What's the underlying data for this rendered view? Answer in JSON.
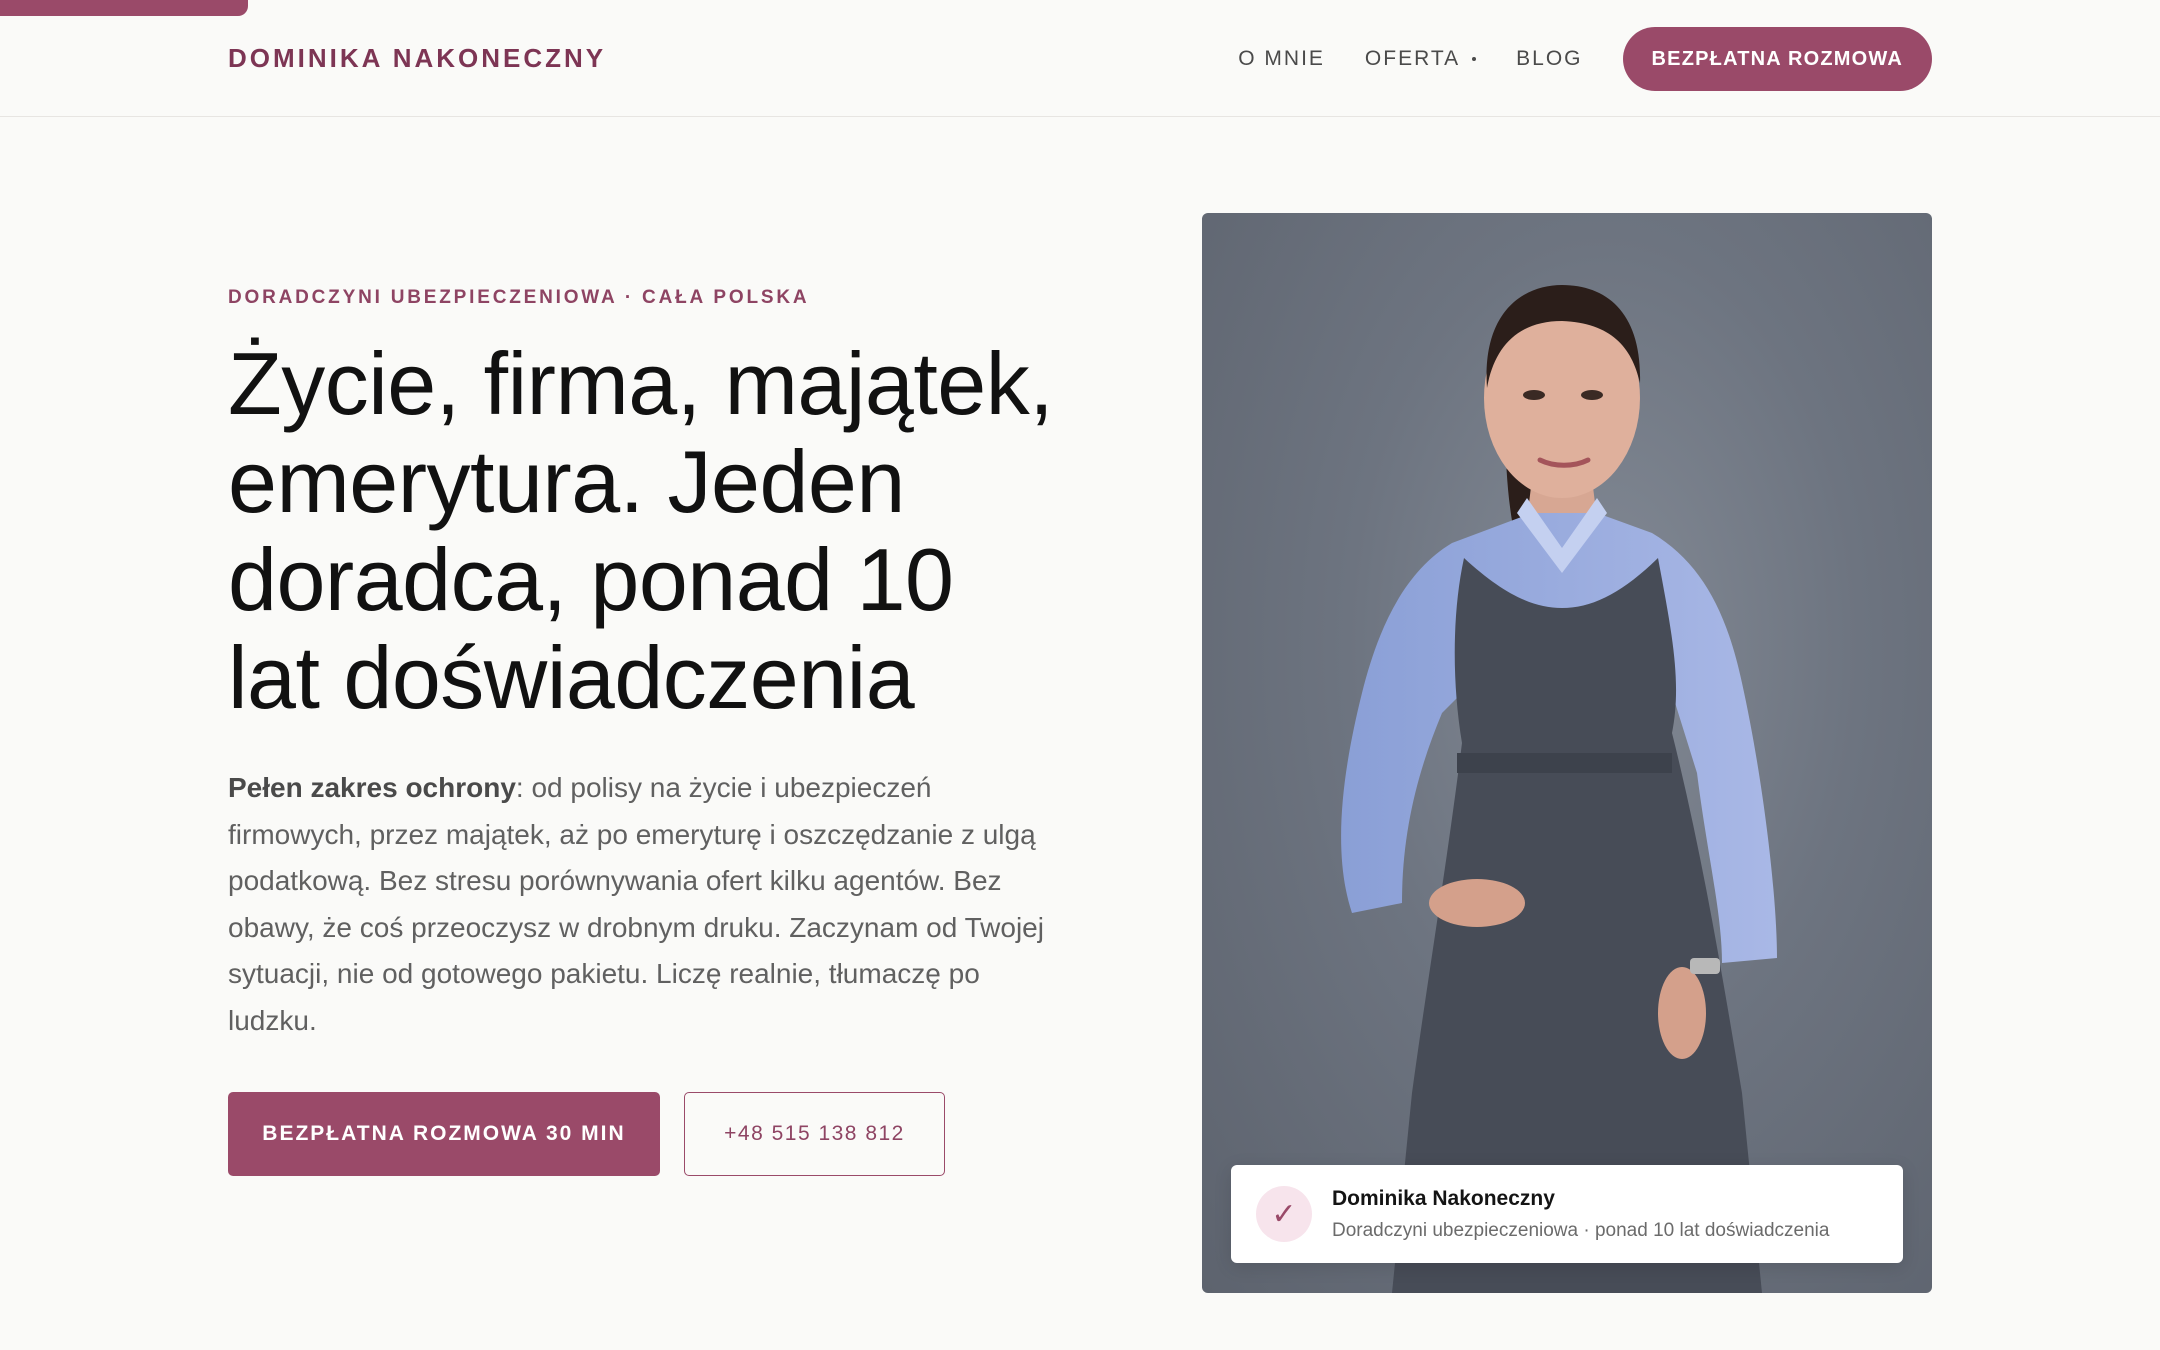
{
  "header": {
    "brand": "DOMINIKA NAKONECZNY",
    "nav": [
      {
        "label": "O MNIE"
      },
      {
        "label": "OFERTA"
      },
      {
        "label": "BLOG"
      }
    ],
    "cta_label": "BEZPŁATNA ROZMOWA"
  },
  "hero": {
    "eyebrow": "DORADCZYNI UBEZPIECZENIOWA · CAŁA POLSKA",
    "title_lines": [
      "Życie, firma, majątek,",
      "emerytura. Jeden",
      "doradca, ponad 10",
      "lat doświadczenia"
    ],
    "description_bold": "Pełen zakres ochrony",
    "description_rest": ": od polisy na życie i ubezpieczeń firmowych, przez majątek, aż po emeryturę i oszczędzanie z ulgą podatkową. Bez stresu porównywania ofert kilku agentów. Bez obawy, że coś przeoczysz w drobnym druku. Zaczynam od Twojej sytuacji, nie od gotowego pakietu. Liczę realnie, tłumaczę po ludzku.",
    "primary_button": "BEZPŁATNA ROZMOWA 30 MIN",
    "phone_button": "+48 515 138 812"
  },
  "portrait_card": {
    "check_icon": "✓",
    "name": "Dominika Nakoneczny",
    "subtitle": "Doradczyni ubezpieczeniowa · ponad 10 lat doświadczenia"
  },
  "colors": {
    "accent": "#9a4a69",
    "brand_text": "#7d3554",
    "background": "#fafaf8",
    "photo_background": "#6d7480"
  }
}
